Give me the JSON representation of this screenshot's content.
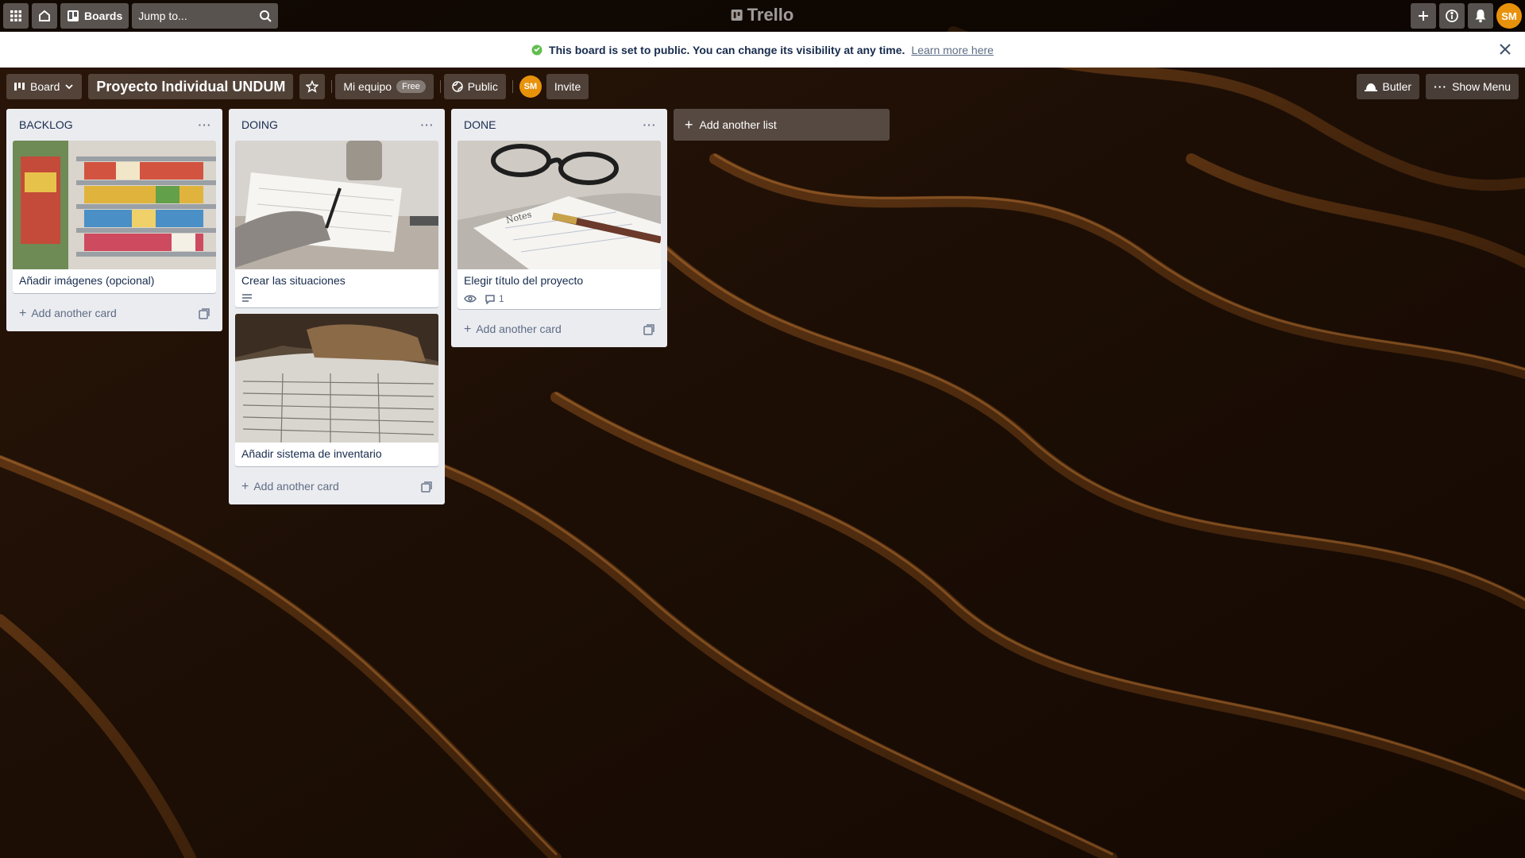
{
  "header": {
    "boards_label": "Boards",
    "search_placeholder": "Jump to...",
    "logo_text": "Trello",
    "user_initials": "SM"
  },
  "banner": {
    "message": "This board is set to public. You can change its visibility at any time.",
    "link": "Learn more here"
  },
  "board_header": {
    "view_label": "Board",
    "title": "Proyecto Individual UNDUM",
    "team": "Mi equipo",
    "team_badge": "Free",
    "visibility": "Public",
    "member_initials": "SM",
    "invite_label": "Invite",
    "butler_label": "Butler",
    "menu_label": "Show Menu"
  },
  "lists": [
    {
      "title": "BACKLOG",
      "add_card": "Add another card",
      "cards": [
        {
          "title": "Añadir imágenes (opcional)",
          "cover": "supermarket-shelves"
        }
      ]
    },
    {
      "title": "DOING",
      "add_card": "Add another card",
      "cards": [
        {
          "title": "Crear las situaciones",
          "cover": "hand-writing",
          "badge_description": true
        },
        {
          "title": "Añadir sistema de inventario",
          "cover": "open-book-table"
        }
      ]
    },
    {
      "title": "DONE",
      "add_card": "Add another card",
      "cards": [
        {
          "title": "Elegir título del proyecto",
          "cover": "notebook-glasses-pen",
          "badge_watch": true,
          "comments": "1"
        }
      ]
    }
  ],
  "add_list_label": "Add another list",
  "colors": {
    "list_bg": "#ebecf0",
    "text": "#172b4d",
    "muted": "#5e6c84",
    "avatar": "#e8920b",
    "banner_icon": "#61bd4f"
  }
}
